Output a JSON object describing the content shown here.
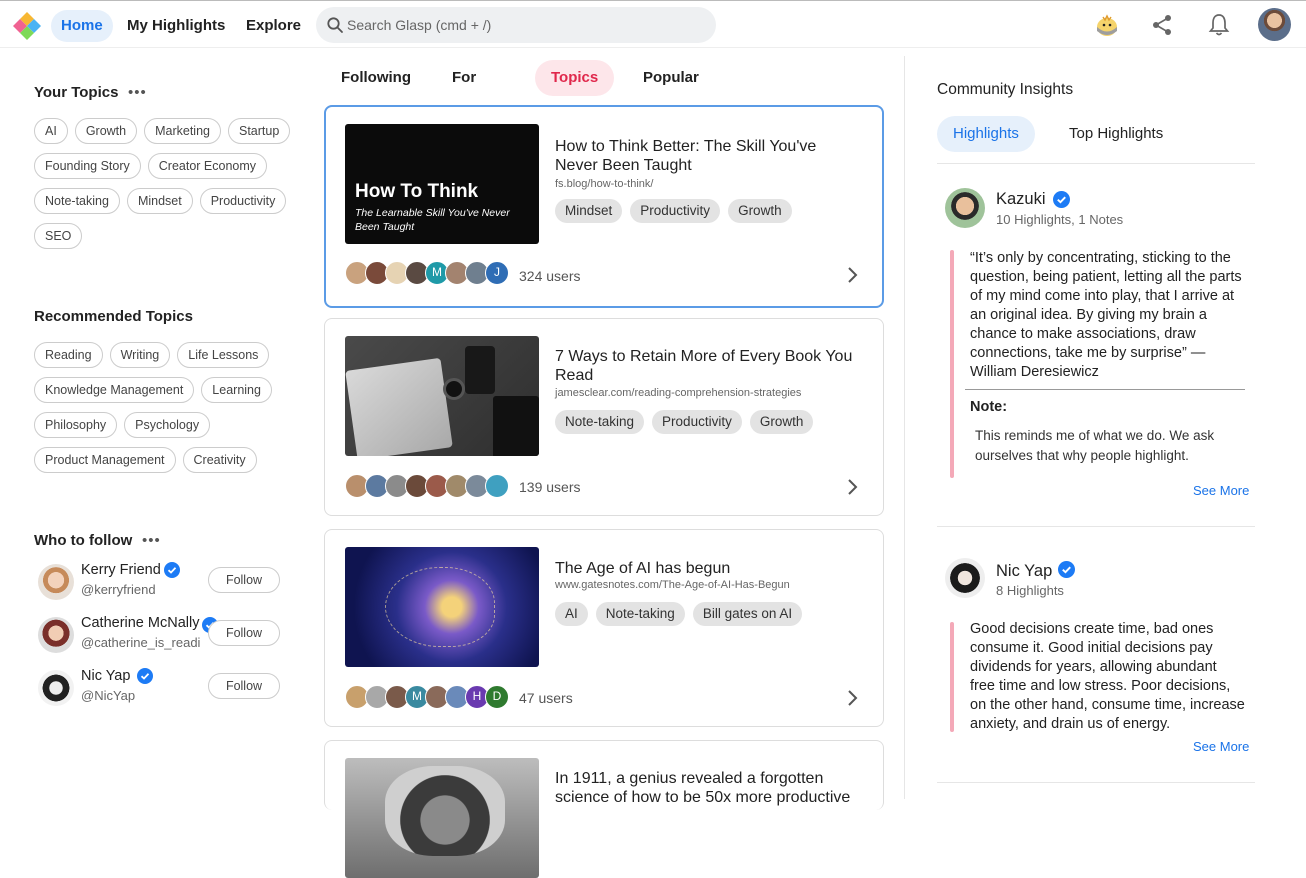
{
  "nav": {
    "home": "Home",
    "my_highlights": "My Highlights",
    "explore": "Explore",
    "search_placeholder": "Search Glasp (cmd + /)"
  },
  "your_topics": {
    "title": "Your Topics",
    "more": "•••",
    "items": [
      "AI",
      "Growth",
      "Marketing",
      "Startup",
      "Founding Story",
      "Creator Economy",
      "Note-taking",
      "Mindset",
      "Productivity",
      "SEO"
    ]
  },
  "recommended_topics": {
    "title": "Recommended Topics",
    "items": [
      "Reading",
      "Writing",
      "Life Lessons",
      "Knowledge Management",
      "Learning",
      "Philosophy",
      "Psychology",
      "Product Management",
      "Creativity"
    ]
  },
  "who_to_follow": {
    "title": "Who to follow",
    "more": "•••",
    "follow_label": "Follow",
    "people": [
      {
        "name": "Kerry Friend",
        "handle": "@kerryfriend"
      },
      {
        "name": "Catherine McNally",
        "handle": "@catherine_is_readin"
      },
      {
        "name": "Nic Yap",
        "handle": "@NicYap"
      }
    ]
  },
  "feed_tabs": [
    "Following",
    "For You",
    "Topics",
    "Popular"
  ],
  "cards": [
    {
      "thumb_title": "How To Think",
      "thumb_sub": "The Learnable Skill You've Never Been Taught",
      "title": "How to Think Better: The Skill You've Never Been Taught",
      "url": "fs.blog/how-to-think/",
      "tags": [
        "Mindset",
        "Productivity",
        "Growth"
      ],
      "users": "324 users",
      "faces": [
        "",
        "",
        "",
        "",
        "M",
        "",
        "",
        "J"
      ]
    },
    {
      "title": "7 Ways to Retain More of Every Book You Read",
      "url": "jamesclear.com/reading-comprehension-strategies",
      "tags": [
        "Note-taking",
        "Productivity",
        "Growth"
      ],
      "users": "139 users",
      "faces": [
        "",
        "",
        "",
        "",
        "",
        "",
        "",
        ""
      ]
    },
    {
      "title": "The Age of AI has begun",
      "url": "www.gatesnotes.com/The-Age-of-AI-Has-Begun",
      "tags": [
        "AI",
        "Note-taking",
        "Bill gates on AI"
      ],
      "users": "47 users",
      "faces": [
        "",
        "",
        "",
        "M",
        "",
        "",
        "H",
        "D"
      ]
    },
    {
      "title": "In 1911, a genius revealed a forgotten science of how to be 50x more productive"
    }
  ],
  "community": {
    "title": "Community Insights",
    "tabs": [
      "Highlights",
      "Top Highlights"
    ],
    "insights": [
      {
        "name": "Kazuki",
        "meta": "10 Highlights, 1 Notes",
        "quote": "“It’s only by concentrating, sticking to the question, being patient, letting all the parts of my mind come into play, that I arrive at an original idea. By giving my brain a chance to make associations, draw connections, take me by surprise” — William Deresiewicz",
        "note_label": "Note:",
        "note": "This reminds me of what we do. We ask ourselves that why people highlight.",
        "see_more": "See More"
      },
      {
        "name": "Nic Yap",
        "meta": "8 Highlights",
        "quote": "Good decisions create time, bad ones consume it. Good initial decisions pay dividends for years, allowing abundant free time and low stress. Poor decisions, on the other hand, consume time, increase anxiety, and drain us of energy.",
        "see_more": "See More"
      }
    ]
  },
  "colors": {
    "accent_blue": "#1a73e8",
    "topics_pink": "#e0284c",
    "quote_bar": "#f4a9b8",
    "verified": "#1d7bf5"
  }
}
